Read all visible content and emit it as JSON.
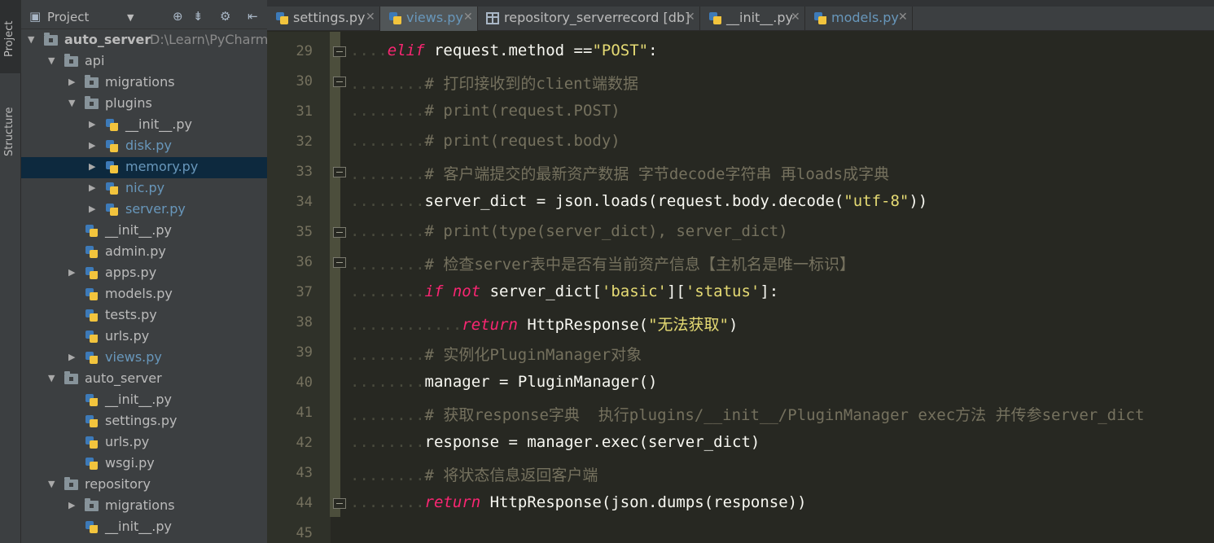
{
  "side_tabs": {
    "project": "Project",
    "structure": "Structure"
  },
  "project_panel": {
    "title": "Project",
    "items": [
      {
        "label": "auto_server",
        "path": "D:\\Learn\\PyCharm\\",
        "type": "folder",
        "level": 0,
        "expanded": true,
        "bold": true
      },
      {
        "label": "api",
        "type": "folder",
        "level": 1,
        "expanded": true
      },
      {
        "label": "migrations",
        "type": "folder",
        "level": 2,
        "expanded": false
      },
      {
        "label": "plugins",
        "type": "folder",
        "level": 2,
        "expanded": true
      },
      {
        "label": "__init__.py",
        "type": "py",
        "level": 3,
        "arrow": true
      },
      {
        "label": "disk.py",
        "type": "py",
        "level": 3,
        "arrow": true,
        "modified": true
      },
      {
        "label": "memory.py",
        "type": "py",
        "level": 3,
        "arrow": true,
        "modified": true,
        "selected": true
      },
      {
        "label": "nic.py",
        "type": "py",
        "level": 3,
        "arrow": true,
        "modified": true
      },
      {
        "label": "server.py",
        "type": "py",
        "level": 3,
        "arrow": true,
        "modified": true
      },
      {
        "label": "__init__.py",
        "type": "py",
        "level": 2
      },
      {
        "label": "admin.py",
        "type": "py",
        "level": 2
      },
      {
        "label": "apps.py",
        "type": "py",
        "level": 2,
        "arrow": true
      },
      {
        "label": "models.py",
        "type": "py",
        "level": 2
      },
      {
        "label": "tests.py",
        "type": "py",
        "level": 2
      },
      {
        "label": "urls.py",
        "type": "py",
        "level": 2
      },
      {
        "label": "views.py",
        "type": "py",
        "level": 2,
        "arrow": true,
        "modified": true
      },
      {
        "label": "auto_server",
        "type": "folder",
        "level": 1,
        "expanded": true
      },
      {
        "label": "__init__.py",
        "type": "py",
        "level": 2
      },
      {
        "label": "settings.py",
        "type": "py",
        "level": 2
      },
      {
        "label": "urls.py",
        "type": "py",
        "level": 2
      },
      {
        "label": "wsgi.py",
        "type": "py",
        "level": 2
      },
      {
        "label": "repository",
        "type": "folder",
        "level": 1,
        "expanded": true
      },
      {
        "label": "migrations",
        "type": "folder",
        "level": 2,
        "expanded": false
      },
      {
        "label": "__init__.py",
        "type": "py",
        "level": 2
      }
    ]
  },
  "tabs": [
    {
      "label": "settings.py",
      "icon": "python-file-icon"
    },
    {
      "label": "views.py",
      "icon": "python-file-icon",
      "active": true,
      "modified": true
    },
    {
      "label": "repository_serverrecord [db]",
      "icon": "table-icon"
    },
    {
      "label": "__init__.py",
      "icon": "python-file-icon"
    },
    {
      "label": "models.py",
      "icon": "python-file-icon",
      "modified": true
    }
  ],
  "editor": {
    "lines": [
      {
        "n": "29",
        "indent": 1,
        "tokens": [
          {
            "t": "elif",
            "c": "kw"
          },
          {
            "t": " request.method ==",
            "c": ""
          },
          {
            "t": "\"POST\"",
            "c": "str"
          },
          {
            "t": ":",
            "c": ""
          }
        ]
      },
      {
        "n": "30",
        "indent": 2,
        "tokens": [
          {
            "t": "# 打印接收到的client端数据",
            "c": "cm"
          }
        ]
      },
      {
        "n": "31",
        "indent": 2,
        "tokens": [
          {
            "t": "# print(request.POST)",
            "c": "cm"
          }
        ]
      },
      {
        "n": "32",
        "indent": 2,
        "tokens": [
          {
            "t": "# print(request.body)",
            "c": "cm"
          }
        ]
      },
      {
        "n": "33",
        "indent": 2,
        "tokens": [
          {
            "t": "# 客户端提交的最新资产数据 字节decode字符串 再loads成字典",
            "c": "cm"
          }
        ]
      },
      {
        "n": "34",
        "indent": 2,
        "tokens": [
          {
            "t": "server_dict = json.loads(request.body.decode(",
            "c": ""
          },
          {
            "t": "\"utf-8\"",
            "c": "str"
          },
          {
            "t": "))",
            "c": ""
          }
        ]
      },
      {
        "n": "35",
        "indent": 2,
        "tokens": [
          {
            "t": "# print(type(server_dict), server_dict)",
            "c": "cm"
          }
        ]
      },
      {
        "n": "36",
        "indent": 2,
        "tokens": [
          {
            "t": "# 检查server表中是否有当前资产信息【主机名是唯一标识】",
            "c": "cm"
          }
        ]
      },
      {
        "n": "37",
        "indent": 2,
        "tokens": [
          {
            "t": "if not",
            "c": "kw"
          },
          {
            "t": " server_dict[",
            "c": ""
          },
          {
            "t": "'basic'",
            "c": "str"
          },
          {
            "t": "][",
            "c": ""
          },
          {
            "t": "'status'",
            "c": "str"
          },
          {
            "t": "]:",
            "c": ""
          }
        ]
      },
      {
        "n": "38",
        "indent": 3,
        "tokens": [
          {
            "t": "return",
            "c": "kw"
          },
          {
            "t": " HttpResponse(",
            "c": ""
          },
          {
            "t": "\"无法获取\"",
            "c": "str"
          },
          {
            "t": ")",
            "c": ""
          }
        ]
      },
      {
        "n": "39",
        "indent": 2,
        "tokens": [
          {
            "t": "# 实例化PluginManager对象",
            "c": "cm"
          }
        ]
      },
      {
        "n": "40",
        "indent": 2,
        "tokens": [
          {
            "t": "manager = PluginManager()",
            "c": ""
          }
        ]
      },
      {
        "n": "41",
        "indent": 2,
        "tokens": [
          {
            "t": "# 获取response字典  执行plugins/__init__/PluginManager exec方法 并传参server_dict",
            "c": "cm"
          }
        ]
      },
      {
        "n": "42",
        "indent": 2,
        "tokens": [
          {
            "t": "response = manager.exec(server_dict)",
            "c": ""
          }
        ]
      },
      {
        "n": "43",
        "indent": 2,
        "tokens": [
          {
            "t": "# 将状态信息返回客户端",
            "c": "cm"
          }
        ]
      },
      {
        "n": "44",
        "indent": 2,
        "tokens": [
          {
            "t": "return",
            "c": "kw"
          },
          {
            "t": " HttpResponse(json.dumps(response))",
            "c": ""
          }
        ]
      },
      {
        "n": "45",
        "indent": 0,
        "tokens": []
      }
    ]
  },
  "colors": {
    "keyword": "#f92672",
    "string": "#e6db74",
    "comment": "#75715e",
    "text": "#f8f8f2",
    "background": "#272822",
    "modified_file": "#6897bb"
  }
}
